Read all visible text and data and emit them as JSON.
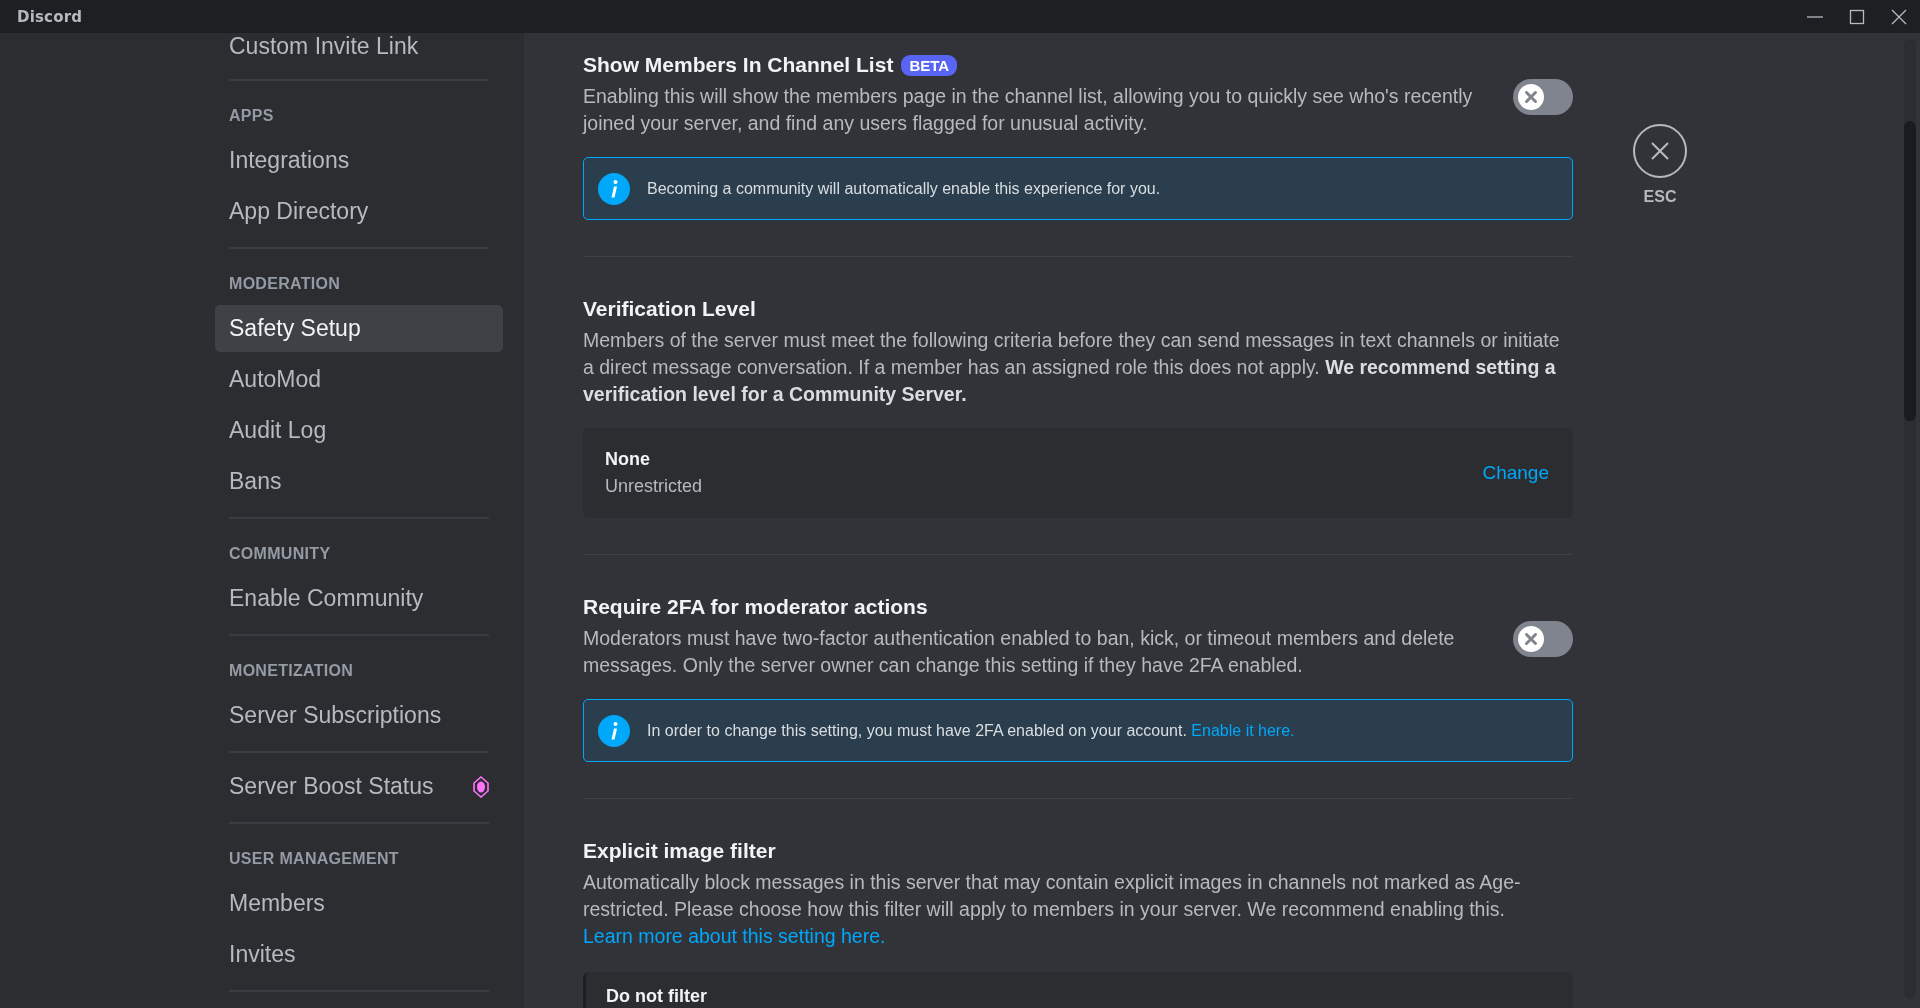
{
  "window": {
    "title": "Discord"
  },
  "sidebar": {
    "groups": [
      {
        "items": [
          {
            "label": "Custom Invite Link",
            "selected": false
          }
        ]
      },
      {
        "heading": "APPS",
        "items": [
          {
            "label": "Integrations",
            "selected": false
          },
          {
            "label": "App Directory",
            "selected": false
          }
        ]
      },
      {
        "heading": "MODERATION",
        "items": [
          {
            "label": "Safety Setup",
            "selected": true
          },
          {
            "label": "AutoMod",
            "selected": false
          },
          {
            "label": "Audit Log",
            "selected": false
          },
          {
            "label": "Bans",
            "selected": false
          }
        ]
      },
      {
        "heading": "COMMUNITY",
        "items": [
          {
            "label": "Enable Community",
            "selected": false
          }
        ]
      },
      {
        "heading": "MONETIZATION",
        "items": [
          {
            "label": "Server Subscriptions",
            "selected": false
          }
        ]
      },
      {
        "items": [
          {
            "label": "Server Boost Status",
            "selected": false,
            "boost": true
          }
        ]
      },
      {
        "heading": "USER MANAGEMENT",
        "items": [
          {
            "label": "Members",
            "selected": false
          },
          {
            "label": "Invites",
            "selected": false
          }
        ]
      }
    ]
  },
  "sections": [
    {
      "kind": "toggle",
      "title": "Show Members In Channel List",
      "badge": "BETA",
      "description": "Enabling this will show the members page in the channel list, allowing you to quickly see who's recently joined your server, and find any users flagged for unusual activity.",
      "on": false,
      "info": {
        "text": "Becoming a community will automatically enable this experience for you."
      }
    },
    {
      "kind": "select",
      "title": "Verification Level",
      "description": "Members of the server must meet the following criteria before they can send messages in text channels or initiate a direct message conversation. If a member has an assigned role this does not apply. **We recommend setting a verification level for a Community Server.**",
      "card": {
        "title": "None",
        "subtitle": "Unrestricted",
        "action": "Change"
      }
    },
    {
      "kind": "toggle",
      "title": "Require 2FA for moderator actions",
      "description": "Moderators must have two-factor authentication enabled to ban, kick, or timeout members and delete messages. Only the server owner can change this setting if they have 2FA enabled.",
      "on": false,
      "info": {
        "text": "In order to change this setting, you must have 2FA enabled on your account.",
        "link": "Enable it here."
      }
    },
    {
      "kind": "options",
      "title": "Explicit image filter",
      "description": "Automatically block messages in this server that may contain explicit images in channels not marked as Age-restricted. Please choose how this filter will apply to members in your server. We recommend enabling this.",
      "link": "Learn more about this setting here.",
      "option": "Do not filter"
    }
  ],
  "close": {
    "label": "ESC"
  }
}
